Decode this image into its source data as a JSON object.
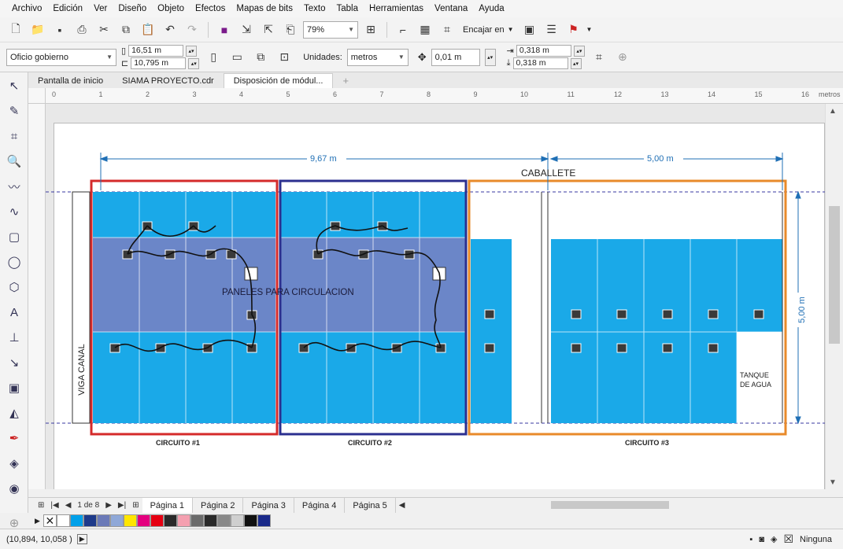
{
  "menu": [
    "Archivo",
    "Edición",
    "Ver",
    "Diseño",
    "Objeto",
    "Efectos",
    "Mapas de bits",
    "Texto",
    "Tabla",
    "Herramientas",
    "Ventana",
    "Ayuda"
  ],
  "toolbar": {
    "zoom": "79%",
    "snap_label": "Encajar en"
  },
  "property_bar": {
    "paper_size": "Oficio gobierno",
    "width": "16,51 m",
    "height": "10,795 m",
    "units_label": "Unidades:",
    "units_value": "metros",
    "nudge": "0,01 m",
    "dup_x": "0,318 m",
    "dup_y": "0,318 m"
  },
  "doc_tabs": [
    "Pantalla de inicio",
    "SIAMA PROYECTO.cdr",
    "Disposición de módul..."
  ],
  "ruler": {
    "unit": "metros",
    "labels": [
      "0",
      "1",
      "2",
      "3",
      "4",
      "5",
      "6",
      "7",
      "8",
      "9",
      "10",
      "11",
      "12",
      "13",
      "14",
      "15",
      "16"
    ]
  },
  "drawing": {
    "dim_top_left": "9,67 m",
    "dim_top_right": "5,00 m",
    "dim_right": "5,00 m",
    "caballete": "CABALLETE",
    "center_label": "PANELES PARA CIRCULACION",
    "viga": "VIGA CANAL",
    "tanque_1": "TANQUE",
    "tanque_2": "DE AGUA",
    "circuits": [
      "CIRCUITO #1",
      "CIRCUITO #2",
      "CIRCUITO #3"
    ],
    "colors": {
      "panel": "#1aa9e8",
      "panel_dark": "#6b86c8",
      "c1": "#d42a2a",
      "c2": "#2b2f8f",
      "c3": "#e88a2a",
      "dim": "#1f6fb5"
    }
  },
  "page_nav": {
    "counter": "1 de 8",
    "pages": [
      "Página 1",
      "Página 2",
      "Página 3",
      "Página 4",
      "Página 5"
    ]
  },
  "palette": [
    "#ffffff",
    "#00a0e9",
    "#1e3a8a",
    "#6b7ab8",
    "#8fa8d8",
    "#ffe600",
    "#e4007f",
    "#e60012",
    "#2a2a2a",
    "#f4a0b0",
    "#6b6b6b",
    "#2a2a2a",
    "#888888",
    "#cfcfcf",
    "#111111",
    "#1a2a8a"
  ],
  "status": {
    "coords": "(10,894, 10,058 )",
    "fill": "Ninguna"
  }
}
